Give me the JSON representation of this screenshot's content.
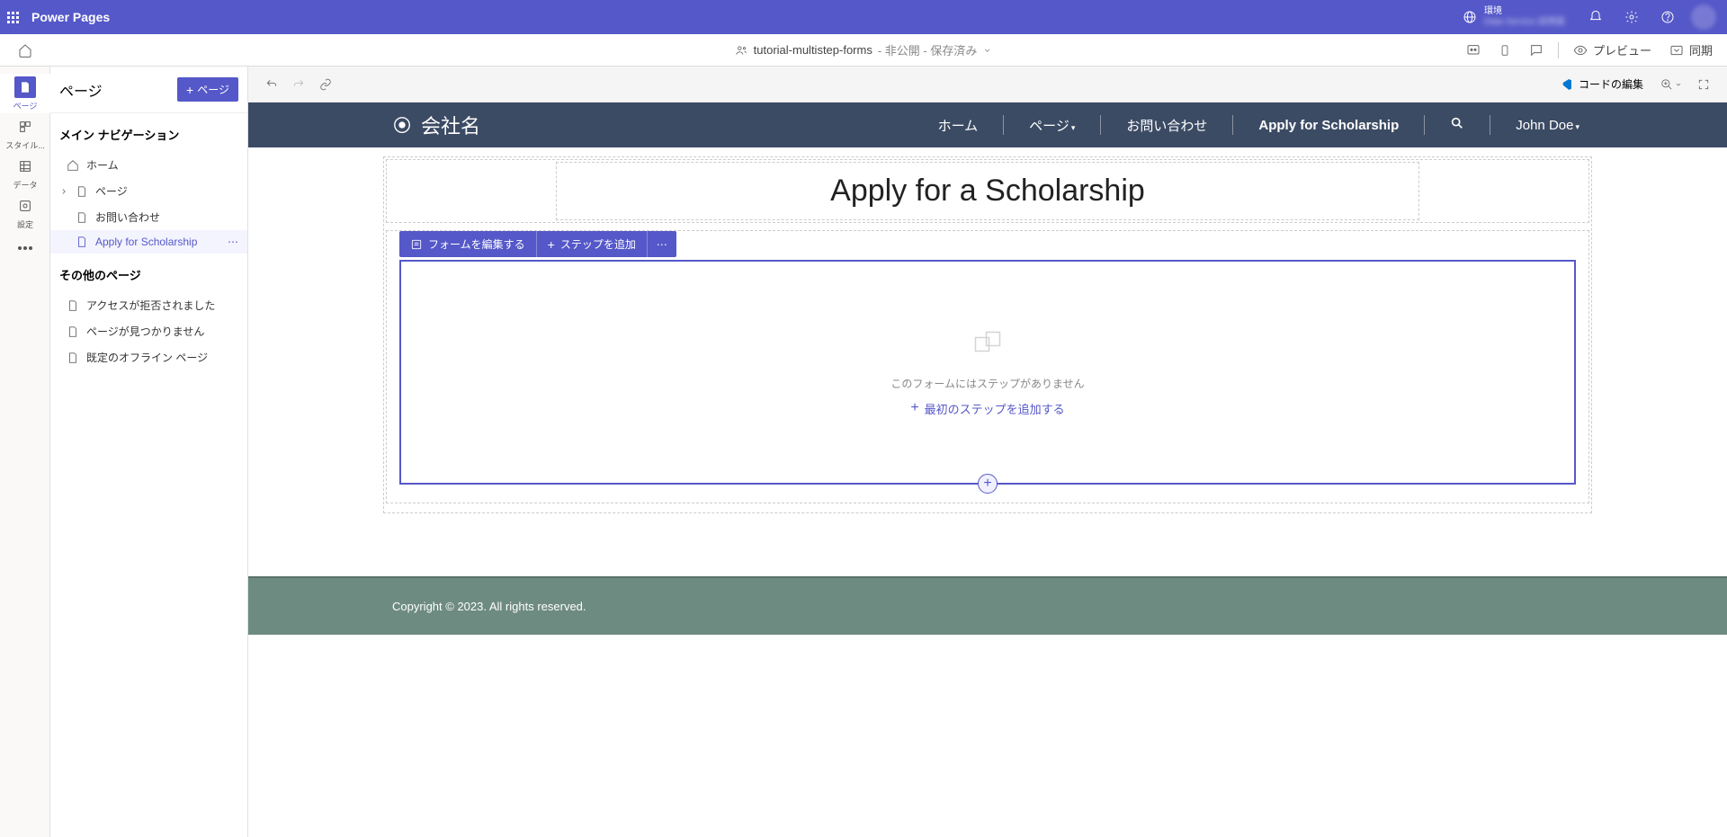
{
  "header": {
    "app_title": "Power Pages",
    "env_label": "環境",
    "env_name": "Data Service 試用版"
  },
  "secondary": {
    "site_name": "tutorial-multistep-forms",
    "status": "- 非公開 - 保存済み",
    "preview": "プレビュー",
    "sync": "同期",
    "edit_code": "コードの編集"
  },
  "rail": {
    "pages": "ページ",
    "style": "スタイル...",
    "data": "データ",
    "settings": "設定"
  },
  "panel": {
    "title": "ページ",
    "add_page": "ページ",
    "main_nav_section": "メイン ナビゲーション",
    "other_pages_section": "その他のページ",
    "items": {
      "home": "ホーム",
      "pages": "ページ",
      "contact": "お問い合わせ",
      "apply": "Apply for Scholarship",
      "access_denied": "アクセスが拒否されました",
      "not_found": "ページが見つかりません",
      "offline": "既定のオフライン ページ"
    }
  },
  "site": {
    "company": "会社名",
    "nav": {
      "home": "ホーム",
      "pages": "ページ",
      "contact": "お問い合わせ",
      "apply": "Apply for Scholarship",
      "user": "John Doe"
    },
    "heading": "Apply for a Scholarship",
    "form_toolbar": {
      "edit": "フォームを編集する",
      "add_step": "ステップを追加"
    },
    "form_empty": "このフォームにはステップがありません",
    "add_first_step": "最初のステップを追加する",
    "footer": "Copyright © 2023. All rights reserved."
  }
}
